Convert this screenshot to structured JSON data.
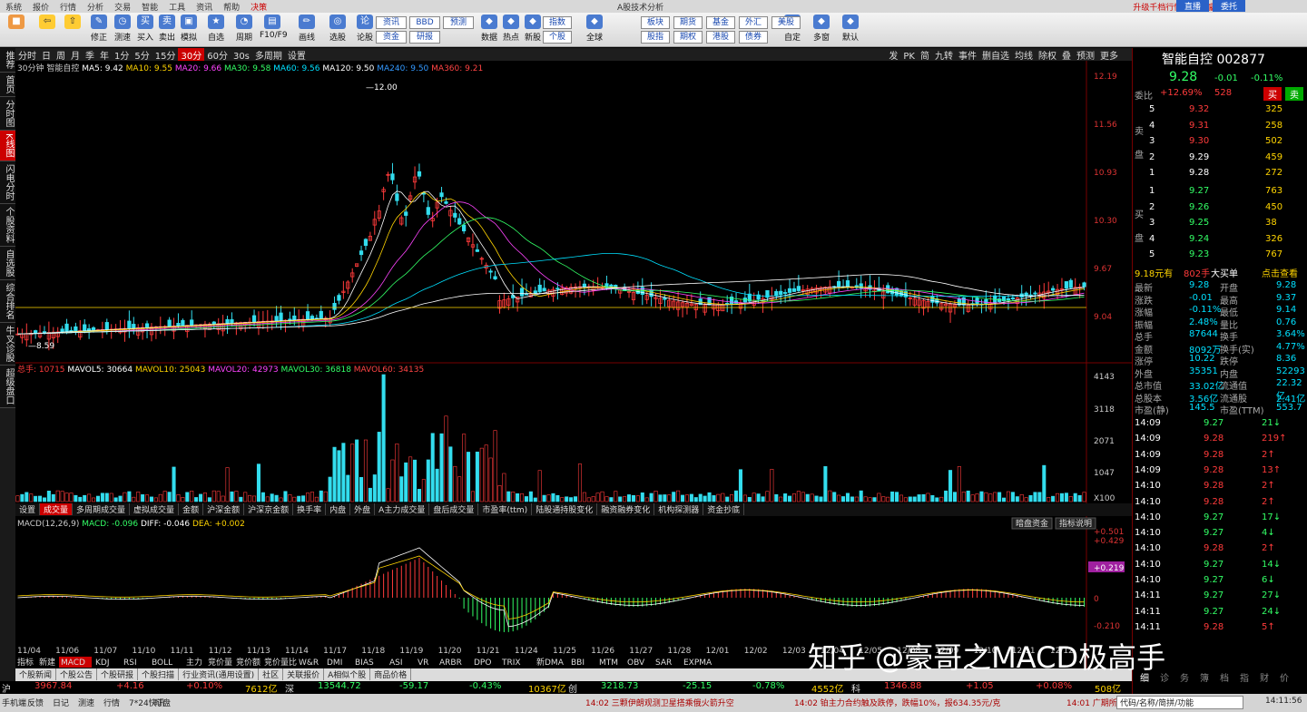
{
  "menu": {
    "items": [
      "系统",
      "报价",
      "行情",
      "分析",
      "交易",
      "智能",
      "工具",
      "资讯",
      "帮助",
      "决策"
    ],
    "center": "A股技术分析",
    "right_links": [
      "升级千档行情界面",
      "豪哥WI"
    ],
    "buttons": [
      "直播",
      "委托"
    ]
  },
  "toolbar": {
    "buttons": [
      "修正",
      "测速",
      "买入",
      "卖出",
      "模拟",
      "自选",
      "周期",
      "F10/F9",
      "画线",
      "选股",
      "论股"
    ],
    "box_rows": [
      [
        "资讯",
        "BBD",
        "预测"
      ],
      [
        "资金",
        "研报"
      ]
    ],
    "right_buttons": [
      "数据",
      "热点",
      "新股",
      "全球",
      "自定",
      "多窗",
      "默认"
    ],
    "boxes2": [
      [
        "指数",
        "个股"
      ],
      [
        "板块",
        "股指"
      ],
      [
        "期货",
        "期权"
      ],
      [
        "基金",
        "港股"
      ],
      [
        "外汇",
        "债券"
      ],
      [
        "美股"
      ]
    ]
  },
  "leftnav": [
    "推荐",
    "首页",
    "分时图",
    "K线图",
    "闪电分时",
    "个股资料",
    "自选股",
    "综合排名",
    "牛叉诊股",
    "超级盘口"
  ],
  "period": {
    "items": [
      "分时",
      "日",
      "周",
      "月",
      "季",
      "年",
      "1分",
      "5分",
      "15分",
      "30分",
      "60分",
      "30s",
      "多周期",
      "设置"
    ],
    "selected": "30分",
    "right": [
      "发",
      "PK",
      "简",
      "九转",
      "事件",
      "删自选",
      "均线",
      "除权",
      "叠",
      "预测",
      "更多"
    ]
  },
  "kline": {
    "period_label": "30分钟",
    "stock": "智能自控",
    "ma": [
      {
        "label": "MA5: 9.42",
        "color": "#ffffff"
      },
      {
        "label": "MA10: 9.55",
        "color": "#ffd400"
      },
      {
        "label": "MA20: 9.66",
        "color": "#ff44ff"
      },
      {
        "label": "MA30: 9.58",
        "color": "#33ff66"
      },
      {
        "label": "MA60: 9.56",
        "color": "#00e0ff"
      },
      {
        "label": "MA120: 9.50",
        "color": "#ffffff"
      },
      {
        "label": "MA240: 9.50",
        "color": "#3399ff"
      },
      {
        "label": "MA360: 9.21",
        "color": "#ff4444"
      }
    ],
    "yticks": [
      "12.19",
      "11.56",
      "10.93",
      "10.30",
      "9.67",
      "9.04"
    ],
    "high_label": "12.00",
    "low_label": "8.59"
  },
  "volume": {
    "label": "总手: 10715",
    "ma": [
      {
        "label": "MAVOL5: 30664",
        "color": "#ffffff"
      },
      {
        "label": "MAVOL10: 25043",
        "color": "#ffd400"
      },
      {
        "label": "MAVOL20: 42973",
        "color": "#ff44ff"
      },
      {
        "label": "MAVOL30: 36818",
        "color": "#33ff66"
      },
      {
        "label": "MAVOL60: 34135",
        "color": "#ff4444"
      }
    ],
    "yticks": [
      "4143",
      "3118",
      "2071",
      "1047",
      "X100"
    ]
  },
  "tabs": {
    "items": [
      "设置",
      "成交量",
      "多周期成交量",
      "虚拟成交量",
      "金额",
      "沪深金额",
      "沪深京金额",
      "换手率",
      "内盘",
      "外盘",
      "A主力成交量",
      "盘后成交量",
      "市盈率(ttm)",
      "陆股通持股变化",
      "融资融券变化",
      "机构探测器",
      "资金抄底"
    ],
    "selected": "成交量"
  },
  "macd": {
    "label": "MACD(12,26,9)",
    "macd_val": "MACD: -0.096",
    "diff_val": "DIFF: -0.046",
    "dea_val": "DEA: +0.002",
    "buttons": [
      "暗盘资金",
      "指标说明"
    ],
    "yticks": [
      "+0.501",
      "+0.429",
      "+0.219",
      "0",
      "-0.210"
    ],
    "highlight": "+0.219"
  },
  "dates": [
    "11/04",
    "11/06",
    "11/07",
    "11/10",
    "11/11",
    "11/12",
    "11/13",
    "11/14",
    "11/17",
    "11/18",
    "11/19",
    "11/20",
    "11/21",
    "11/24",
    "11/25",
    "11/26",
    "11/27",
    "11/28",
    "12/01",
    "12/02",
    "12/03",
    "12/04",
    "12/05",
    "12/08",
    "12/09",
    "12/10",
    "12/11",
    "12/12"
  ],
  "bottomtabs": [
    "个股新闻",
    "个股公告",
    "个股研报",
    "个股扫描",
    "行业资讯(通用设置)",
    "社区",
    "关联报价",
    "A相似个股",
    "商品价格"
  ],
  "indicator_tabs": [
    "指标",
    "新建",
    "MACD",
    "KDJ",
    "RSI",
    "BOLL",
    "主力",
    "竞价量",
    "竞价额",
    "竞价量比",
    "W&R",
    "DMI",
    "BIAS",
    "ASI",
    "VR",
    "ARBR",
    "DPO",
    "TRIX",
    "新DMA",
    "BBI",
    "MTM",
    "OBV",
    "SAR",
    "EXPMA"
  ],
  "indexbar": [
    {
      "name": "沪",
      "val": "3967.84",
      "chg": "+4.16",
      "pct": "+0.10%",
      "amt": "7612亿"
    },
    {
      "name": "深",
      "val": "13544.72",
      "chg": "-59.17",
      "pct": "-0.43%",
      "amt": "10367亿"
    },
    {
      "name": "创",
      "val": "3218.73",
      "chg": "-25.15",
      "pct": "-0.78%",
      "amt": "4552亿"
    },
    {
      "name": "科",
      "val": "1346.88",
      "chg": "+1.05",
      "pct": "+0.08%",
      "amt": "508亿"
    }
  ],
  "status": {
    "items": [
      "手机端",
      "反馈",
      "日记",
      "测速",
      "行情",
      "7*24快讯",
      "盯盘"
    ],
    "news1": "14:02 三颗伊朗观测卫星搭乘俄火箭升空",
    "news2": "14:02 铂主力合约触及跌停，跌幅10%，报634.35元/克",
    "news3": "14:01 广期所",
    "search": "代码/名称/简拼/功能",
    "time": "14:11:56"
  },
  "quote": {
    "name": "智能自控 002877",
    "price": "9.28",
    "chg": "-0.01",
    "pct": "-0.11%",
    "weibi": "委比",
    "weibi_val": "+12.69%",
    "weicha": "528",
    "buy": "买",
    "sell": "卖",
    "asks": [
      {
        "lv": "5",
        "p": "9.32",
        "v": "325"
      },
      {
        "lv": "4",
        "p": "9.31",
        "v": "258"
      },
      {
        "lv": "3",
        "p": "9.30",
        "v": "502"
      },
      {
        "lv": "2",
        "p": "9.29",
        "v": "459"
      },
      {
        "lv": "1",
        "p": "9.28",
        "v": "272"
      }
    ],
    "bids": [
      {
        "lv": "1",
        "p": "9.27",
        "v": "763"
      },
      {
        "lv": "2",
        "p": "9.26",
        "v": "450"
      },
      {
        "lv": "3",
        "p": "9.25",
        "v": "38"
      },
      {
        "lv": "4",
        "p": "9.24",
        "v": "326"
      },
      {
        "lv": "5",
        "p": "9.23",
        "v": "767"
      }
    ],
    "ask_label": "卖盘",
    "bid_label": "买盘",
    "bigorder": "9.18元有",
    "bigorder_v": "802手",
    "bigorder_t": "大买单",
    "view": "点击查看",
    "stats": [
      [
        "最新",
        "9.28",
        "开盘",
        "9.28"
      ],
      [
        "涨跌",
        "-0.01",
        "最高",
        "9.37"
      ],
      [
        "涨幅",
        "-0.11%",
        "最低",
        "9.14"
      ],
      [
        "振幅",
        "2.48%",
        "量比",
        "0.76"
      ],
      [
        "总手",
        "87644",
        "换手",
        "3.64%"
      ],
      [
        "金额",
        "8092万",
        "换手(实)",
        "4.77%"
      ],
      [
        "涨停",
        "10.22",
        "跌停",
        "8.36"
      ],
      [
        "外盘",
        "35351",
        "内盘",
        "52293"
      ],
      [
        "总市值",
        "33.02亿",
        "流通值",
        "22.32亿"
      ],
      [
        "总股本",
        "3.56亿",
        "流通股",
        "2.41亿"
      ],
      [
        "市盈(静)",
        "145.5",
        "市盈(TTM)",
        "553.7"
      ]
    ],
    "ticks": [
      [
        "14:09",
        "9.27",
        "21",
        "g"
      ],
      [
        "14:09",
        "9.28",
        "219",
        "r"
      ],
      [
        "14:09",
        "9.28",
        "2",
        "r"
      ],
      [
        "14:09",
        "9.28",
        "13",
        "r"
      ],
      [
        "14:10",
        "9.28",
        "2",
        "r"
      ],
      [
        "14:10",
        "9.28",
        "2",
        "r"
      ],
      [
        "14:10",
        "9.27",
        "17",
        "g"
      ],
      [
        "14:10",
        "9.27",
        "4",
        "g"
      ],
      [
        "14:10",
        "9.28",
        "2",
        "r"
      ],
      [
        "14:10",
        "9.27",
        "14",
        "g"
      ],
      [
        "14:10",
        "9.27",
        "6",
        "g"
      ],
      [
        "14:11",
        "9.27",
        "27",
        "g"
      ],
      [
        "14:11",
        "9.27",
        "24",
        "g"
      ],
      [
        "14:11",
        "9.28",
        "5",
        "r"
      ]
    ],
    "bottom_tabs": [
      "细",
      "诊",
      "务",
      "簿",
      "档",
      "指",
      "财",
      "价"
    ]
  },
  "watermark": "知乎 @豪哥之MACD极高手"
}
